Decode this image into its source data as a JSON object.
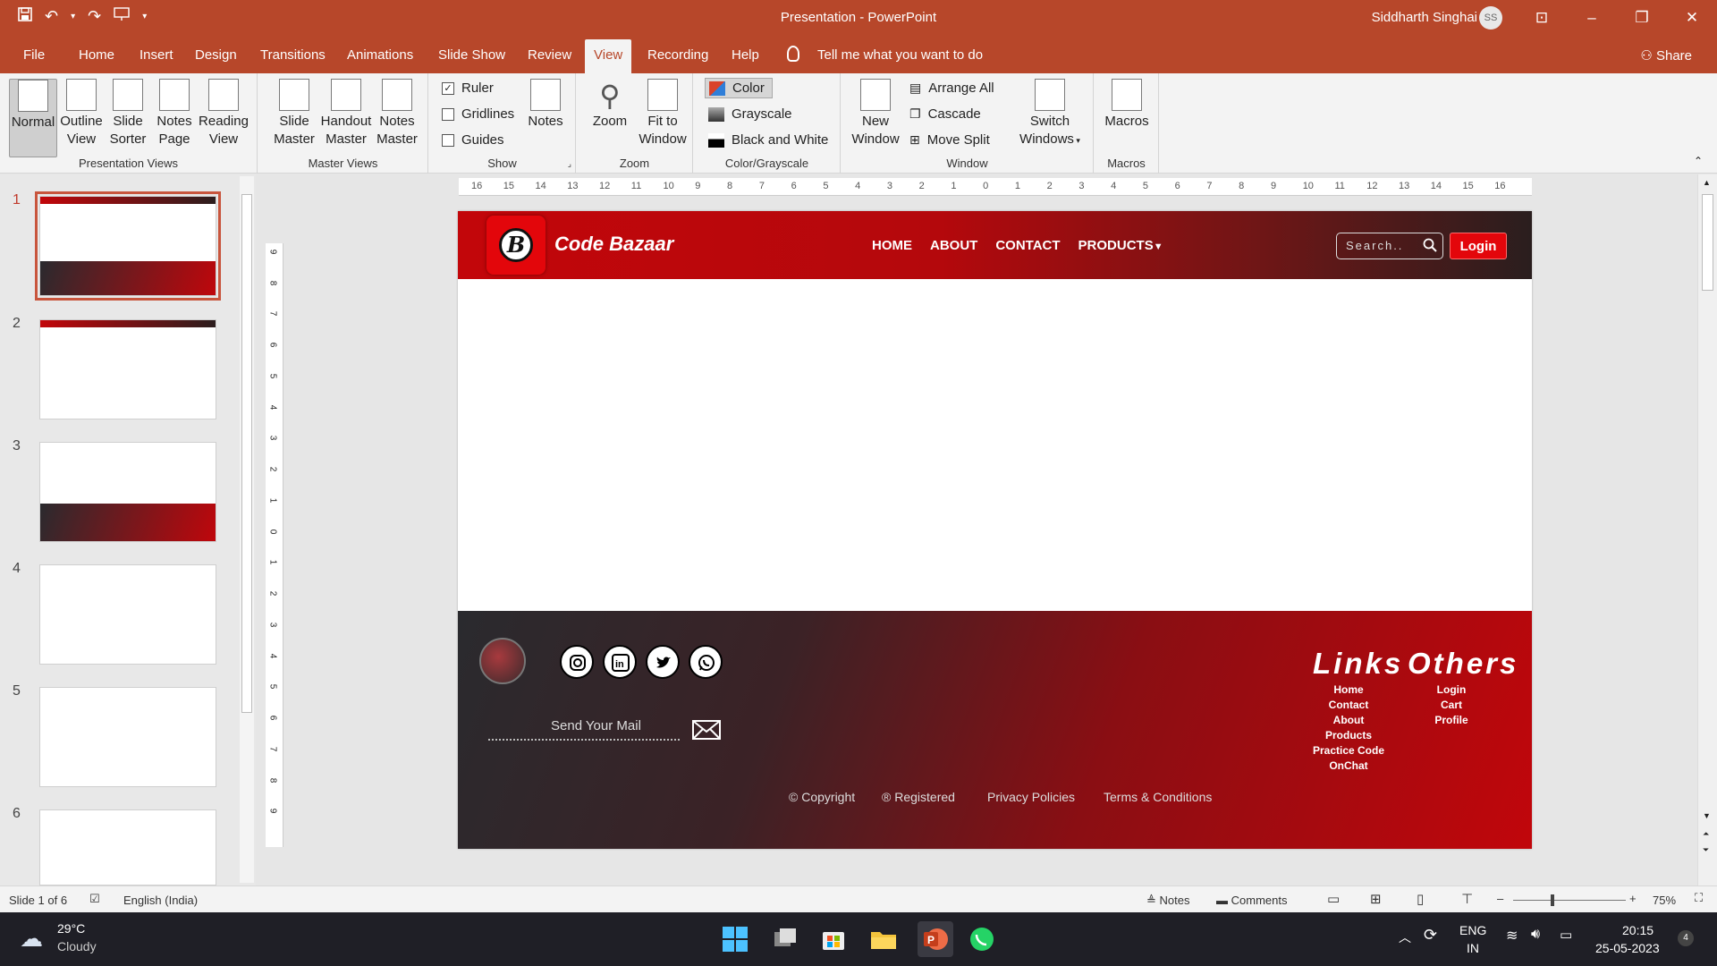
{
  "titlebar": {
    "title": "Presentation  -  PowerPoint",
    "user": "Siddharth Singhai",
    "avatar": "SS"
  },
  "tabs": [
    "File",
    "Home",
    "Insert",
    "Design",
    "Transitions",
    "Animations",
    "Slide Show",
    "Review",
    "View",
    "Recording",
    "Help"
  ],
  "active_tab": "View",
  "tell_me": "Tell me what you want to do",
  "share": "Share",
  "ribbon": {
    "presentation_views": {
      "label": "Presentation Views",
      "buttons": [
        [
          "Normal"
        ],
        [
          "Outline",
          "View"
        ],
        [
          "Slide",
          "Sorter"
        ],
        [
          "Notes",
          "Page"
        ],
        [
          "Reading",
          "View"
        ]
      ]
    },
    "master_views": {
      "label": "Master Views",
      "buttons": [
        [
          "Slide",
          "Master"
        ],
        [
          "Handout",
          "Master"
        ],
        [
          "Notes",
          "Master"
        ]
      ]
    },
    "show": {
      "label": "Show",
      "ruler": "Ruler",
      "ruler_checked": true,
      "gridlines": "Gridlines",
      "guides": "Guides",
      "notes": "Notes"
    },
    "zoom": {
      "label": "Zoom",
      "zoom": "Zoom",
      "fit": [
        "Fit to",
        "Window"
      ]
    },
    "color": {
      "label": "Color/Grayscale",
      "color": "Color",
      "grayscale": "Grayscale",
      "bw": "Black and White"
    },
    "window": {
      "label": "Window",
      "new_window": [
        "New",
        "Window"
      ],
      "arrange_all": "Arrange All",
      "cascade": "Cascade",
      "move_split": "Move Split",
      "switch": [
        "Switch",
        "Windows"
      ]
    },
    "macros": {
      "label": "Macros",
      "macros": "Macros"
    }
  },
  "slides": [
    "1",
    "2",
    "3",
    "4",
    "5",
    "6"
  ],
  "ruler_h": [
    "16",
    "15",
    "14",
    "13",
    "12",
    "11",
    "10",
    "9",
    "8",
    "7",
    "6",
    "5",
    "4",
    "3",
    "2",
    "1",
    "0",
    "1",
    "2",
    "3",
    "4",
    "5",
    "6",
    "7",
    "8",
    "9",
    "10",
    "11",
    "12",
    "13",
    "14",
    "15",
    "16"
  ],
  "ruler_v": [
    "9",
    "8",
    "7",
    "6",
    "5",
    "4",
    "3",
    "2",
    "1",
    "0",
    "1",
    "2",
    "3",
    "4",
    "5",
    "6",
    "7",
    "8",
    "9"
  ],
  "slide": {
    "brand": "Code Bazaar",
    "logo_letter": "B",
    "nav": [
      "HOME",
      "ABOUT",
      "CONTACT",
      "PRODUCTS"
    ],
    "products_caret": "▼",
    "search": "Search..",
    "login": "Login",
    "send_mail": "Send Your Mail",
    "links_head": "Links",
    "links": [
      "Home",
      "Contact",
      "About",
      "Products",
      "Practice Code",
      "OnChat"
    ],
    "others_head": "Others",
    "others": [
      "Login",
      "Cart",
      "Profile"
    ],
    "copyright": "Copyright",
    "registered": "Registered",
    "privacy": "Privacy Policies",
    "terms": "Terms & Conditions",
    "accent": "#e3060b"
  },
  "status": {
    "slide": "Slide 1 of 6",
    "lang": "English (India)",
    "notes": "Notes",
    "comments": "Comments",
    "zoom": "75%"
  },
  "taskbar": {
    "temp": "29°C",
    "weather": "Cloudy",
    "lang1": "ENG",
    "lang2": "IN",
    "time": "20:15",
    "date": "25-05-2023",
    "badge": "4"
  }
}
